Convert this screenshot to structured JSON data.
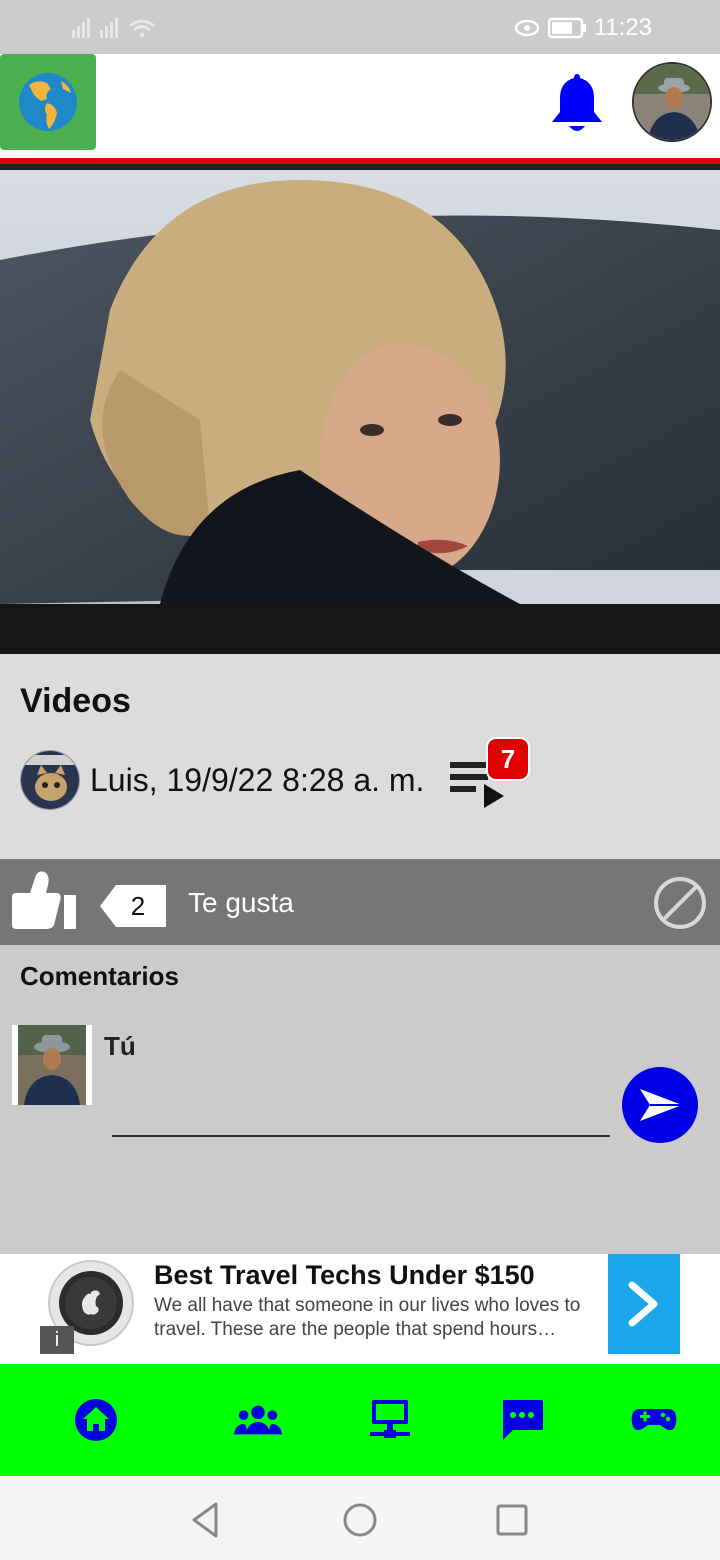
{
  "status_bar": {
    "time": "11:23"
  },
  "app_bar": {
    "globe_icon": "globe-americas-icon",
    "notifications_icon": "bell-icon",
    "colors": {
      "globe_bg": "#4caf50",
      "bell": "#0000ff",
      "accent_line": "#e10000"
    }
  },
  "post": {
    "section_title": "Videos",
    "author_meta": "Luis, 19/9/22 8:28 a. m.",
    "playlist_badge": "7"
  },
  "like_bar": {
    "count": "2",
    "label": "Te gusta"
  },
  "comments": {
    "title": "Comentarios",
    "current_user_name": "Tú",
    "input_value": ""
  },
  "ad": {
    "title": "Best Travel Techs Under $150",
    "description": "We all have that someone in our lives who loves to travel. These are the people that spend hours…",
    "info_icon": "i"
  },
  "bottom_nav": {
    "items": [
      "home-icon",
      "people-icon",
      "desktop-network-icon",
      "chat-icon",
      "gamepad-icon"
    ],
    "colors": {
      "bg": "#00ff00",
      "icon": "#0000e6"
    }
  }
}
